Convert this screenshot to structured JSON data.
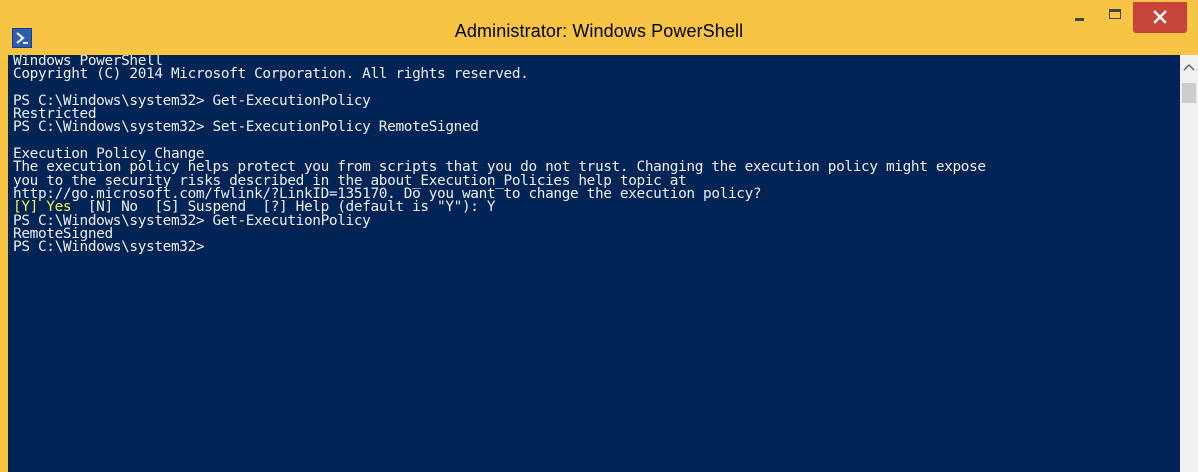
{
  "window": {
    "title": "Administrator: Windows PowerShell",
    "icon": "powershell-icon",
    "controls": {
      "minimize": "minimize-icon",
      "maximize": "maximize-icon",
      "close": "close-icon"
    }
  },
  "colors": {
    "frame": "#f7c444",
    "console_background": "#012456",
    "console_text": "#eeedf0",
    "prompt_highlight": "#f3f34d",
    "close_button": "#c7443c"
  },
  "console": {
    "lines": [
      "Windows PowerShell",
      "Copyright (C) 2014 Microsoft Corporation. All rights reserved.",
      "",
      "PS C:\\Windows\\system32> Get-ExecutionPolicy",
      "Restricted",
      "PS C:\\Windows\\system32> Set-ExecutionPolicy RemoteSigned",
      "",
      "Execution Policy Change",
      "The execution policy helps protect you from scripts that you do not trust. Changing the execution policy might expose",
      "you to the security risks described in the about_Execution_Policies help topic at",
      "http://go.microsoft.com/fwlink/?LinkID=135170. Do you want to change the execution policy?"
    ],
    "choice_prompt": {
      "highlighted": "[Y] Yes",
      "rest": "  [N] No  [S] Suspend  [?] Help (default is \"Y\"): Y"
    },
    "after_lines": [
      "PS C:\\Windows\\system32> Get-ExecutionPolicy",
      "RemoteSigned",
      "PS C:\\Windows\\system32>"
    ]
  },
  "scrollbar": {
    "up_arrow": "chevron-up-icon"
  }
}
